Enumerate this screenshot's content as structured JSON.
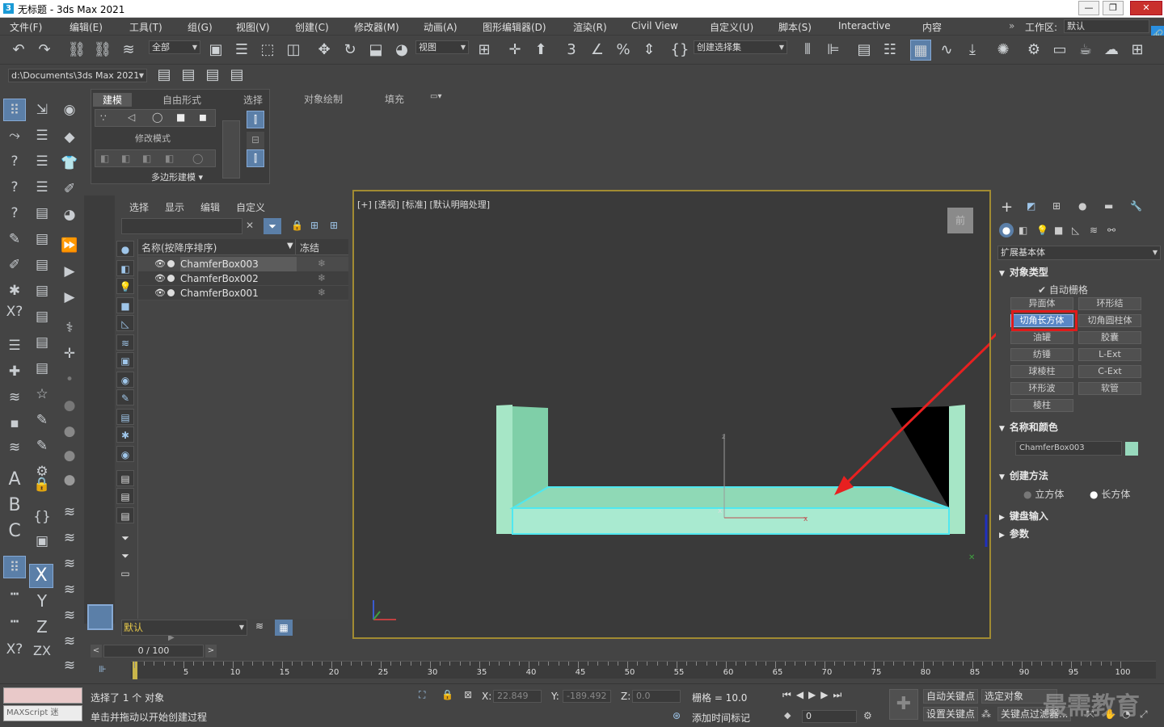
{
  "window": {
    "title": "无标题 - 3ds Max 2021",
    "minimize": "—",
    "maximize": "❐",
    "close": "✕"
  },
  "menu": [
    "文件(F)",
    "编辑(E)",
    "工具(T)",
    "组(G)",
    "视图(V)",
    "创建(C)",
    "修改器(M)",
    "动画(A)",
    "图形编辑器(D)",
    "渲染(R)",
    "Civil View",
    "自定义(U)",
    "脚本(S)",
    "Interactive",
    "内容"
  ],
  "workspace": {
    "label": "工作区:",
    "value": "默认"
  },
  "toolbar": {
    "filter_value": "全部",
    "refcoord_value": "视图",
    "selset_placeholder": "创建选择集"
  },
  "project_path": "d:\\Documents\\3ds Max 2021",
  "ribbon": {
    "tabs": [
      "建模",
      "自由形式",
      "选择",
      "对象绘制",
      "填充"
    ],
    "active_tab": "建模",
    "modify_mode_label": "修改模式",
    "poly_label": "多边形建模 ▾"
  },
  "explorer": {
    "menu": [
      "选择",
      "显示",
      "编辑",
      "自定义"
    ],
    "col_name": "名称(按降序排序)",
    "col_freeze": "冻结",
    "objects": [
      "ChamferBox003",
      "ChamferBox002",
      "ChamferBox001"
    ],
    "layer_value": "默认"
  },
  "viewport": {
    "label": "[+] [透视] [标准] [默认明暗处理]",
    "viewcube_label": "前",
    "object_color": "#98d9bd",
    "selection_color": "#4fe8f0"
  },
  "command_panel": {
    "category_value": "扩展基本体",
    "object_type_header": "对象类型",
    "auto_grid_label": "自动栅格",
    "object_buttons": [
      "异面体",
      "环形结",
      "切角长方体",
      "切角圆柱体",
      "油罐",
      "胶囊",
      "纺锤",
      "L-Ext",
      "球棱柱",
      "C-Ext",
      "环形波",
      "软管",
      "棱柱"
    ],
    "selected_button": "切角长方体",
    "name_color_header": "名称和颜色",
    "object_name": "ChamferBox003",
    "object_swatch": "#98d9bd",
    "creation_method_header": "创建方法",
    "creation_options": [
      "立方体",
      "长方体"
    ],
    "creation_selected": "长方体",
    "keyboard_header": "键盘输入",
    "params_header": "参数"
  },
  "timeline": {
    "frame_display": "0 / 100",
    "ticks": [
      "5",
      "10",
      "15",
      "20",
      "25",
      "30",
      "35",
      "40",
      "45",
      "50",
      "55",
      "60",
      "65",
      "70",
      "75",
      "80",
      "85",
      "90",
      "95",
      "100"
    ]
  },
  "status": {
    "maxscript_placeholder": "MAXScript 迷",
    "selected_text": "选择了 1 个 对象",
    "prompt_text": "单击并拖动以开始创建过程",
    "x_label": "X:",
    "x_value": "22.849",
    "y_label": "Y:",
    "y_value": "-189.492",
    "z_label": "Z:",
    "z_value": "0.0",
    "grid_text": "栅格 = 10.0",
    "add_time_tag": "添加时间标记",
    "auto_key": "自动关键点",
    "selected_object": "选定对象",
    "set_key": "设置关键点",
    "key_filter": "关键点过滤器...",
    "frame_value": "0"
  },
  "watermark": "最需教育"
}
